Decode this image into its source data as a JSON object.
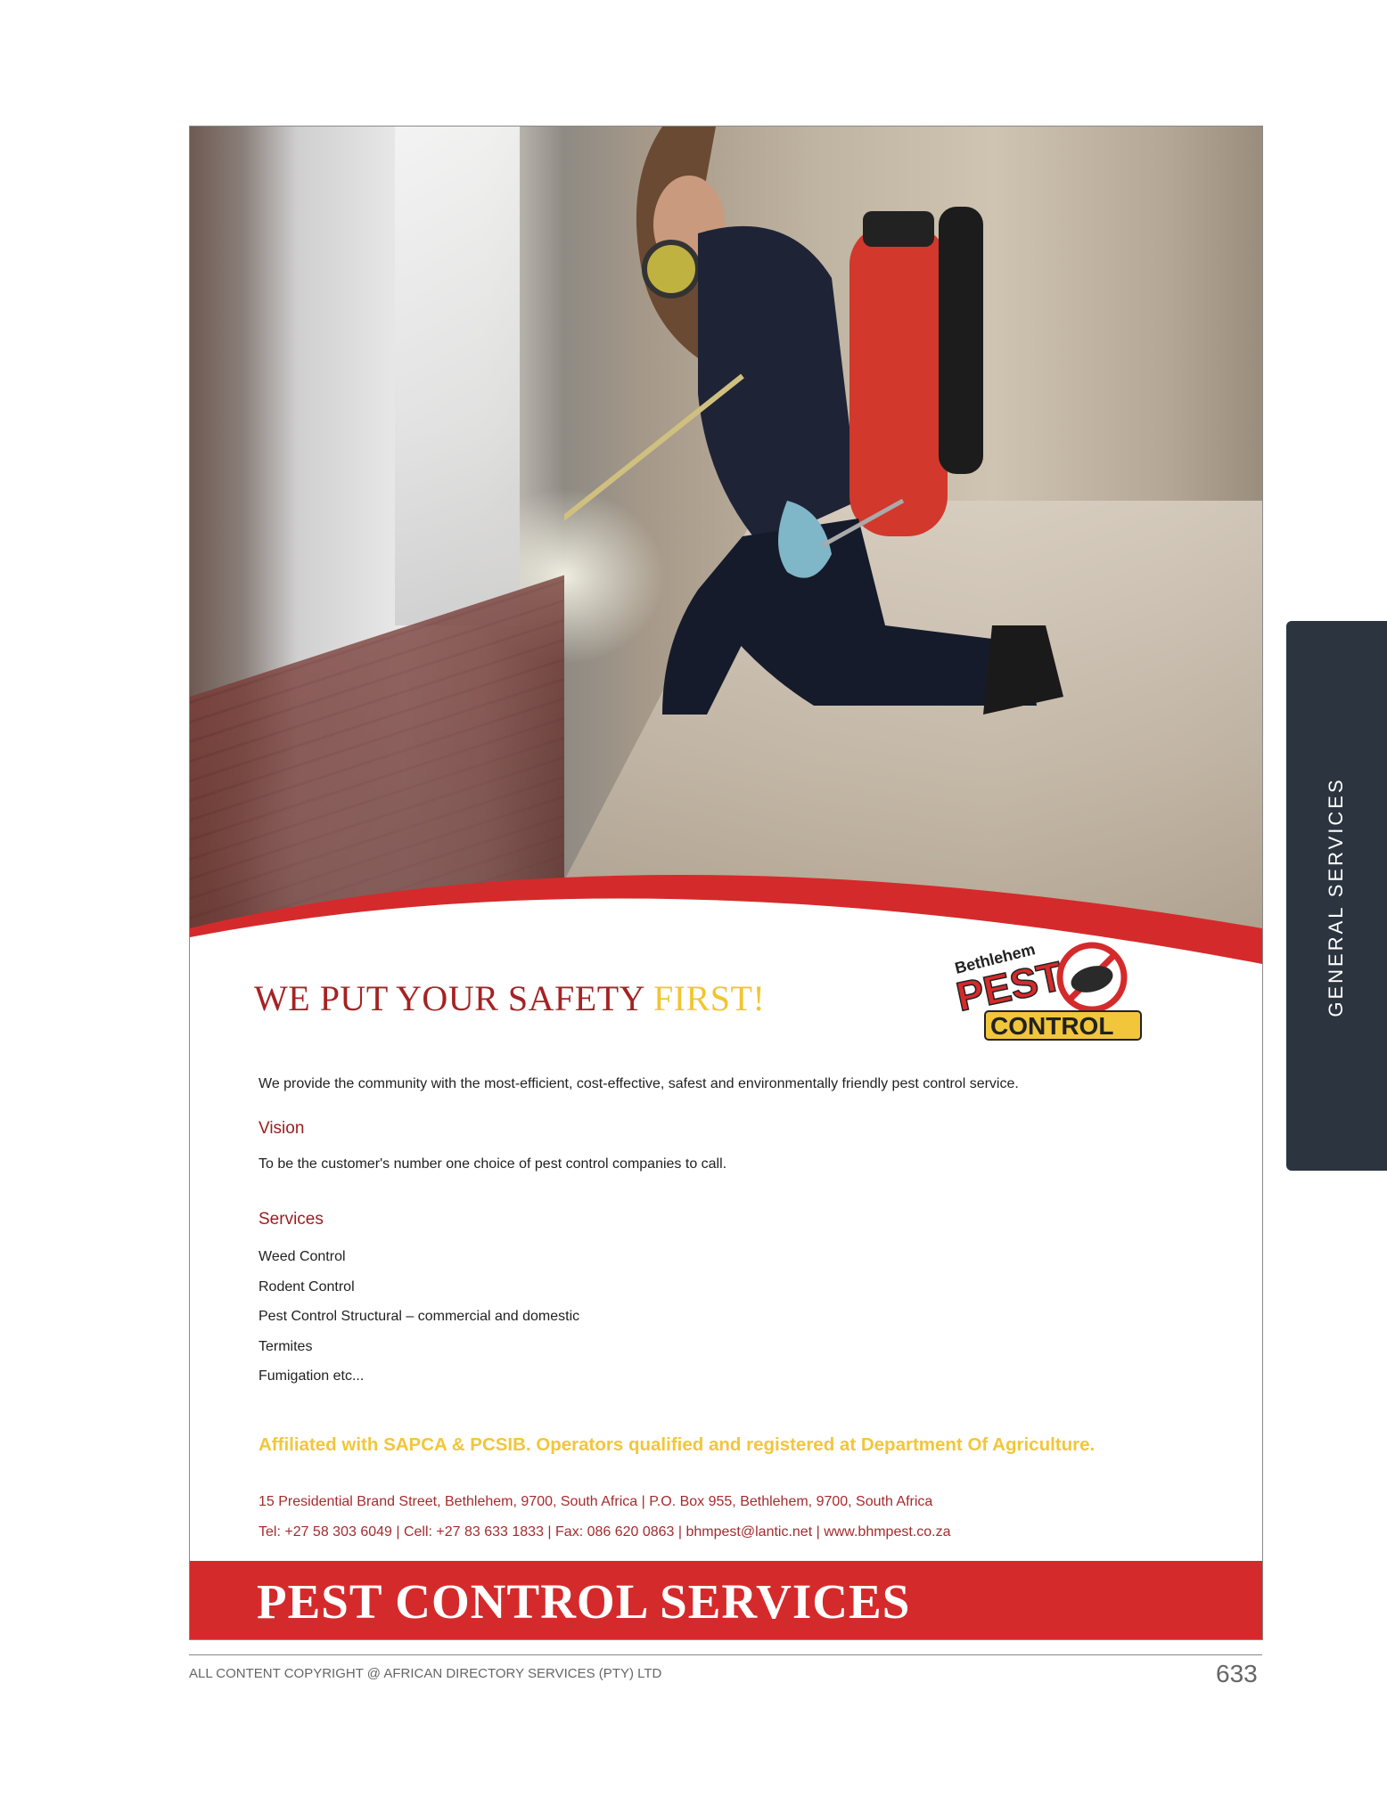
{
  "ad": {
    "headline_main": "WE PUT YOUR SAFETY ",
    "headline_accent": "FIRST!",
    "logo": {
      "top_text": "Bethlehem",
      "middle_text": "PEST",
      "bottom_text": "CONTROL"
    },
    "intro": "We provide the community with the most-efficient, cost-effective, safest and environmentally friendly pest control service.",
    "vision_heading": "Vision",
    "vision_text": "To be the customer's number one choice of pest  control companies to call.",
    "services_heading": "Services",
    "services": [
      "Weed Control",
      "Rodent Control",
      "Pest Control Structural – commercial and domestic",
      "Termites",
      "Fumigation etc..."
    ],
    "affiliation": "Affiliated with SAPCA & PCSIB. Operators qualified and registered at Department Of  Agriculture.",
    "address_line": "15 Presidential Brand Street, Bethlehem, 9700, South Africa |  P.O. Box 955, Bethlehem, 9700, South Africa",
    "contact_line": "Tel: +27 58 303 6049  |  Cell: +27 83 633 1833 |  Fax: 086 620 0863  |  bhmpest@lantic.net | www.bhmpest.co.za",
    "banner": "PEST CONTROL SERVICES"
  },
  "side_tab": "GENERAL SERVICES",
  "footer": {
    "copyright": "ALL CONTENT COPYRIGHT @ AFRICAN DIRECTORY SERVICES (PTY) LTD",
    "page_number": "633"
  },
  "colors": {
    "brand_red": "#d52a2b",
    "headline_red": "#a52224",
    "accent_yellow": "#f1c52e",
    "tab_dark": "#2c353f"
  }
}
